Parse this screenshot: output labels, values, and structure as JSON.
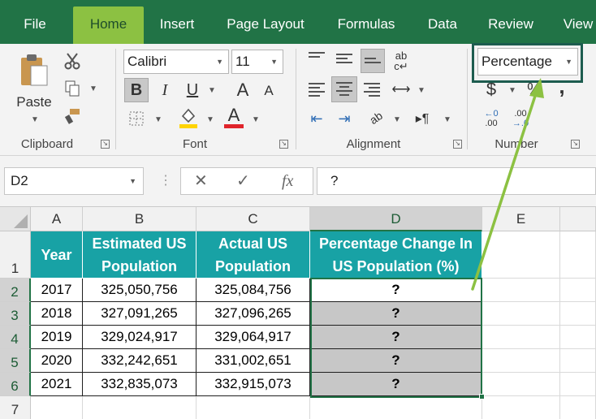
{
  "menu": {
    "tabs": [
      "File",
      "Home",
      "Insert",
      "Page Layout",
      "Formulas",
      "Data",
      "Review",
      "View"
    ],
    "active": "Home"
  },
  "ribbon": {
    "clipboard": {
      "paste_label": "Paste",
      "group_label": "Clipboard"
    },
    "font": {
      "font_name": "Calibri",
      "font_size": "11",
      "bold": "B",
      "italic": "I",
      "underline": "U",
      "grow": "A",
      "shrink": "A",
      "font_color_letter": "A",
      "group_label": "Font",
      "fill_color": "#ffd400",
      "font_color": "#e0242b"
    },
    "alignment": {
      "wrap_glyph": "ab",
      "orientation": "ab",
      "group_label": "Alignment"
    },
    "number": {
      "format": "Percentage",
      "currency": "$",
      "percent": "%",
      "comma": ",",
      "inc_decimal_top": "←0",
      "inc_decimal_bottom": ".00",
      "dec_decimal_top": ".00",
      "dec_decimal_bottom": "→.0",
      "group_label": "Number"
    }
  },
  "formula_bar": {
    "name_box": "D2",
    "cancel": "✕",
    "enter": "✓",
    "fx": "fx",
    "content": "?"
  },
  "sheet": {
    "columns": [
      "A",
      "B",
      "C",
      "D",
      "E"
    ],
    "rows": [
      "1",
      "2",
      "3",
      "4",
      "5",
      "6",
      "7"
    ],
    "headers": {
      "year": "Year",
      "estimated": "Estimated US Population",
      "actual": "Actual US Population",
      "change": "Percentage Change In US Population (%)"
    },
    "data": [
      {
        "year": "2017",
        "estimated": "325,050,756",
        "actual": "325,084,756",
        "change": "?"
      },
      {
        "year": "2018",
        "estimated": "327,091,265",
        "actual": "327,096,265",
        "change": "?"
      },
      {
        "year": "2019",
        "estimated": "329,024,917",
        "actual": "329,064,917",
        "change": "?"
      },
      {
        "year": "2020",
        "estimated": "332,242,651",
        "actual": "331,002,651",
        "change": "?"
      },
      {
        "year": "2021",
        "estimated": "332,835,073",
        "actual": "332,915,073",
        "change": "?"
      }
    ]
  },
  "colors": {
    "excel_green": "#217346",
    "active_tab": "#8cc142",
    "header_fill": "#18a2a5",
    "arrow": "#8cc142"
  }
}
